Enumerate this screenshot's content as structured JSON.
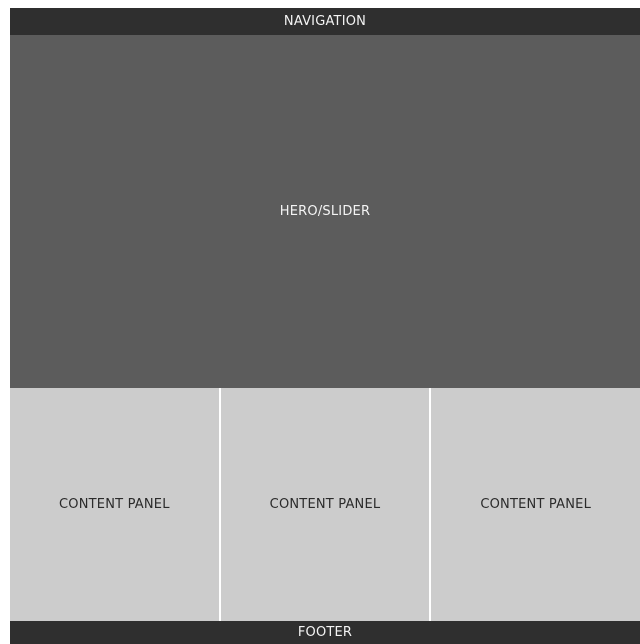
{
  "navigation": {
    "label": "NAVIGATION"
  },
  "hero": {
    "label": "HERO/SLIDER"
  },
  "content_panels": [
    {
      "label": "CONTENT PANEL"
    },
    {
      "label": "CONTENT PANEL"
    },
    {
      "label": "CONTENT PANEL"
    }
  ],
  "footer": {
    "label": "FOOTER"
  },
  "colors": {
    "navigation_bg": "#2f2f2f",
    "hero_bg": "#5c5c5c",
    "panel_bg": "#cccccc",
    "footer_bg": "#2f2f2f"
  }
}
